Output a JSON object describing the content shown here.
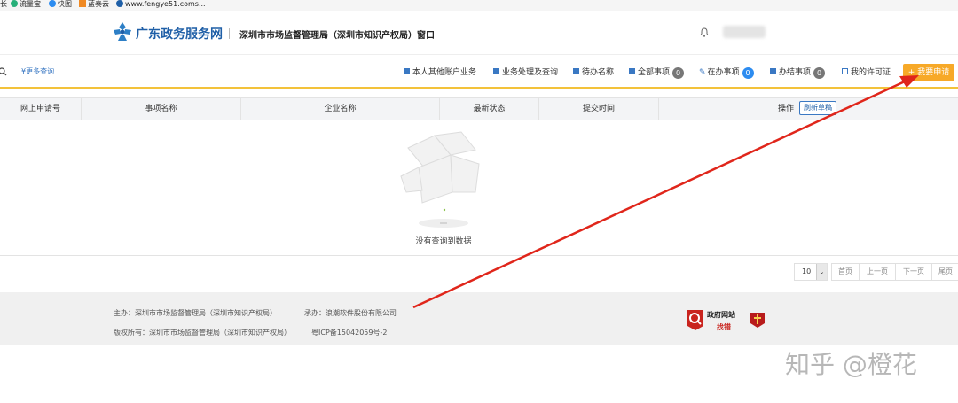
{
  "bookmarks": [
    "长",
    "流量宝",
    "快图",
    "蓝奏云",
    "www.fengye51.coms..."
  ],
  "header": {
    "site_name": "广东政务服务网",
    "department": "深圳市市场监督管理局（深圳市知识产权局）窗口"
  },
  "nav": {
    "more_query": "更多查询",
    "items": [
      {
        "label": "本人其他账户业务"
      },
      {
        "label": "业务处理及查询"
      },
      {
        "label": "待办名称"
      },
      {
        "label": "全部事项",
        "count": "0"
      },
      {
        "label": "在办事项",
        "count": "0"
      },
      {
        "label": "办结事项",
        "count": "0"
      },
      {
        "label": "我的许可证"
      }
    ],
    "apply_label": "我要申请"
  },
  "table": {
    "columns": [
      "网上申请号",
      "事项名称",
      "企业名称",
      "最新状态",
      "提交时间",
      "操作"
    ],
    "refresh_label": "刷新草稿",
    "empty_text": "没有查询到数据"
  },
  "pagination": {
    "page_size": "10",
    "first": "首页",
    "prev": "上一页",
    "next": "下一页",
    "last": "尾页"
  },
  "footer": {
    "host": "主办：深圳市市场监督管理局（深圳市知识产权局）",
    "organizer": "承办：浪潮软件股份有限公司",
    "copyright": "版权所有：深圳市市场监督管理局（深圳市知识产权局）",
    "icp": "粤ICP备15042059号-2",
    "badge_line1": "政府网站",
    "badge_line2": "找错"
  },
  "watermark": "知乎 @橙花",
  "colors": {
    "accent": "#f7a928",
    "brand": "#1f5fa7",
    "arrow": "#e0261b"
  }
}
